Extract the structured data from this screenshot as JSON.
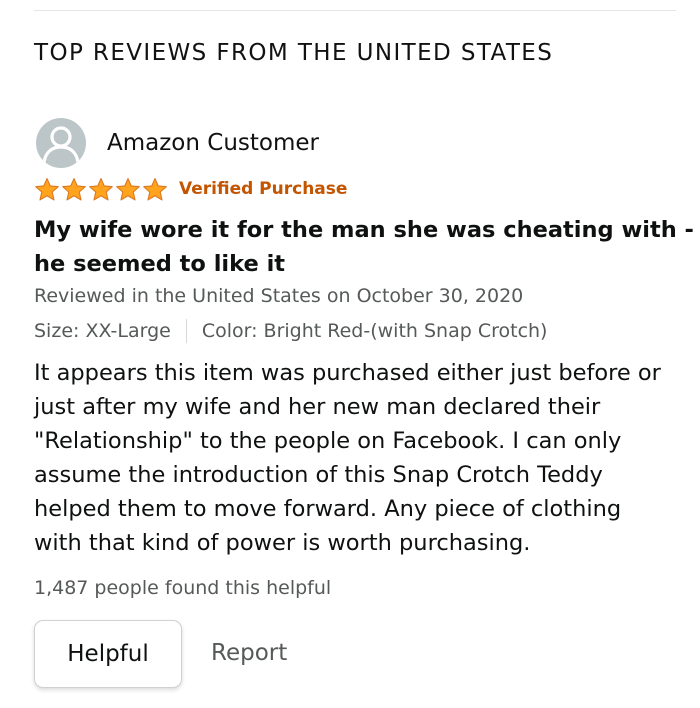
{
  "section": {
    "heading": "TOP REVIEWS FROM THE UNITED STATES"
  },
  "review": {
    "reviewer_name": "Amazon Customer",
    "avatar_icon": "user-silhouette-icon",
    "rating": 5,
    "rating_max": 5,
    "star_color": "#ffa41c",
    "verified_label": "Verified Purchase",
    "verified_color": "#c45500",
    "title_lines": [
      "My wife wore it for the man she was cheating with -",
      "he seemed to like it"
    ],
    "date_text": "Reviewed in the United States on October 30, 2020",
    "size_text": "Size: XX-Large",
    "color_text": "Color: Bright Red-(with Snap Crotch)",
    "body_lines": [
      "It appears this item was purchased either just before or",
      "just after my wife and her new man declared their",
      "\"Relationship\" to the people on Facebook. I can only",
      "assume the introduction of this Snap Crotch Teddy",
      "helped them to move forward. Any piece of clothing",
      "with that kind of power is worth purchasing."
    ],
    "helpful_count_text": "1,487 people found this helpful",
    "helpful_button_label": "Helpful",
    "report_label": "Report"
  }
}
